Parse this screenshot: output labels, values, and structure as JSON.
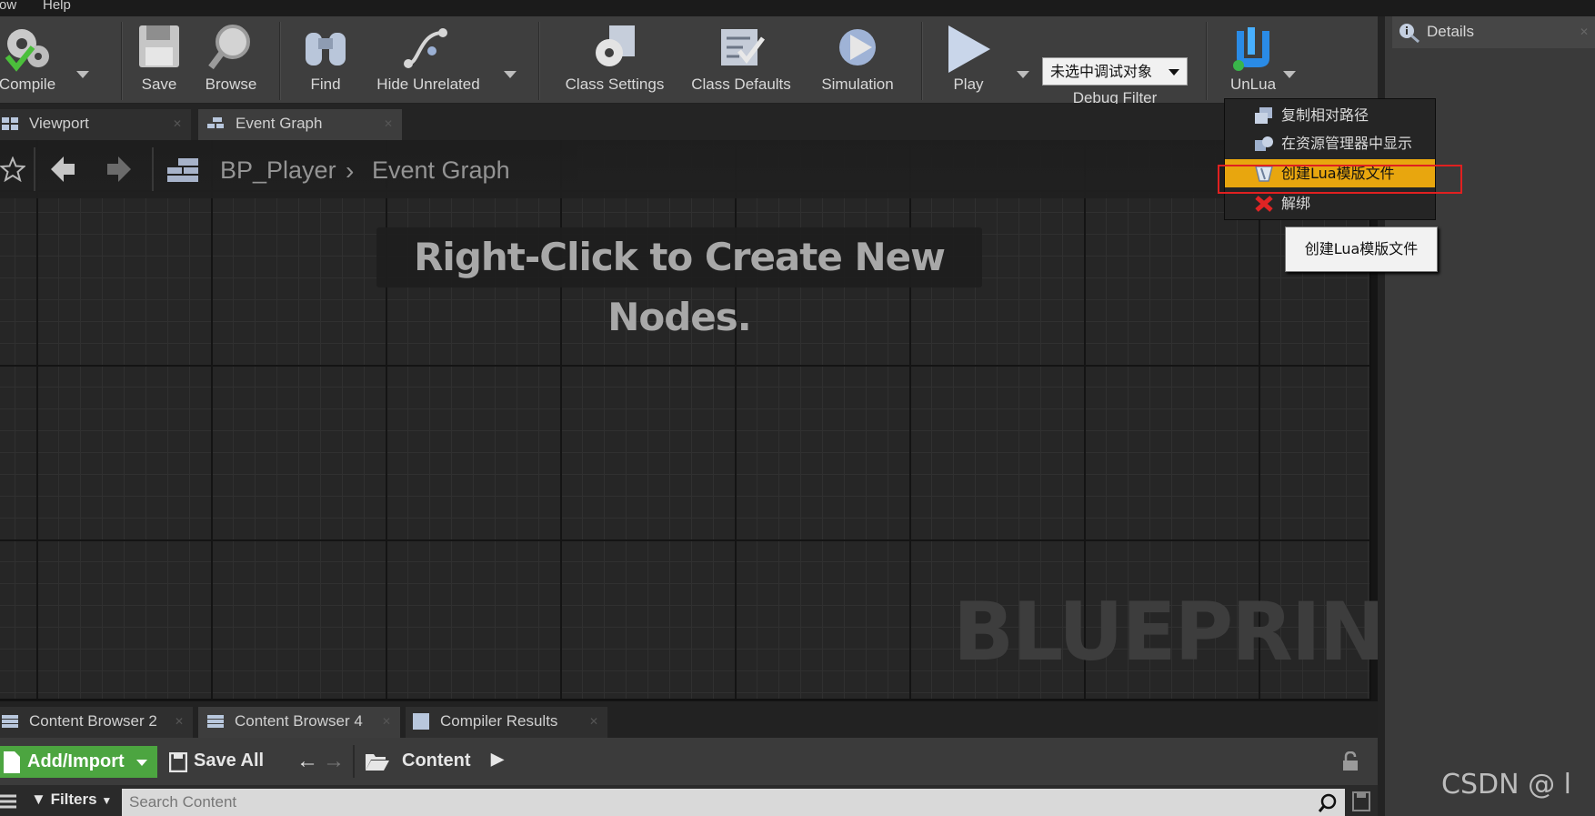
{
  "menubar": {
    "items": [
      "ow",
      "Help"
    ]
  },
  "toolbar": {
    "compile": "Compile",
    "save": "Save",
    "browse": "Browse",
    "find": "Find",
    "hide_unrelated": "Hide Unrelated",
    "class_settings": "Class Settings",
    "class_defaults": "Class Defaults",
    "simulation": "Simulation",
    "play": "Play",
    "debug_select": "未选中调试对象",
    "debug_filter": "Debug Filter",
    "unlua": "UnLua"
  },
  "editor_tabs": [
    {
      "label": "Viewport"
    },
    {
      "label": "Event Graph"
    }
  ],
  "graph": {
    "breadcrumb_root": "BP_Player",
    "breadcrumb_leaf": "Event Graph",
    "hint": "Right-Click to Create New Nodes.",
    "watermark": "BLUEPRINT"
  },
  "details": {
    "label": "Details"
  },
  "unlua_menu": {
    "items": [
      {
        "label": "复制相对路径",
        "icon": "copy-path-icon"
      },
      {
        "label": "在资源管理器中显示",
        "icon": "show-in-explorer-icon"
      },
      {
        "label": "创建Lua模版文件",
        "icon": "create-template-icon",
        "highlighted": true
      },
      {
        "label": "解绑",
        "icon": "unbind-x-icon"
      }
    ],
    "tooltip": "创建Lua模版文件",
    "highlight_color": "#e8a60e"
  },
  "bottom_tabs": [
    {
      "label": "Content Browser 2"
    },
    {
      "label": "Content Browser 4"
    },
    {
      "label": "Compiler Results"
    }
  ],
  "content_browser": {
    "add_import": "Add/Import",
    "save_all": "Save All",
    "path": "Content",
    "filters": "Filters",
    "search_placeholder": "Search Content"
  },
  "watermark_text": "CSDN @ l"
}
